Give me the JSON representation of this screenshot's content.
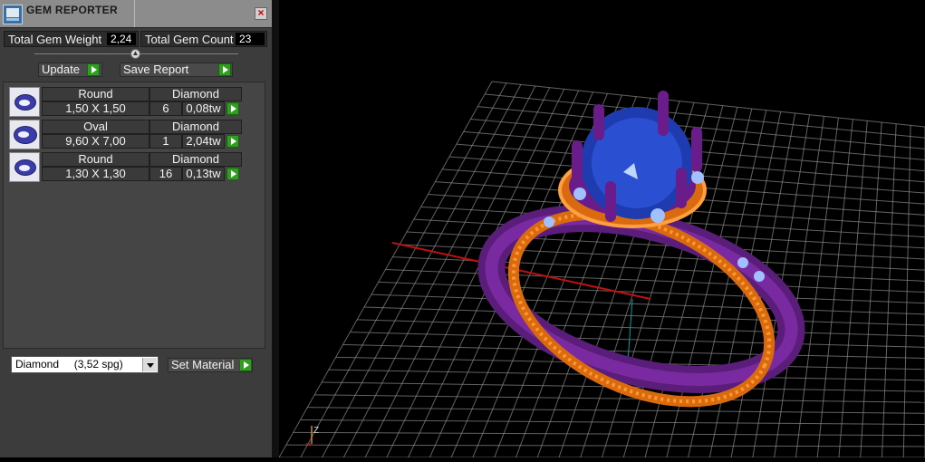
{
  "window": {
    "title": "GEM REPORTER"
  },
  "stats": {
    "weight_label": "Total Gem Weight",
    "weight_value": "2,24",
    "count_label": "Total Gem Count",
    "count_value": "23"
  },
  "actions": {
    "update_label": "Update",
    "save_label": "Save Report"
  },
  "gems": [
    {
      "shape": "Round",
      "material": "Diamond",
      "size": "1,50 X 1,50",
      "count": "6",
      "weight": "0,08tw"
    },
    {
      "shape": "Oval",
      "material": "Diamond",
      "size": "9,60 X 7,00",
      "count": "1",
      "weight": "2,04tw"
    },
    {
      "shape": "Round",
      "material": "Diamond",
      "size": "1,30 X 1,30",
      "count": "16",
      "weight": "0,13tw"
    }
  ],
  "material_select": {
    "value": "Diamond     (3,52 spg)",
    "set_label": "Set Material"
  },
  "viewport": {
    "axis_label": "Z",
    "colors": {
      "metal": "#f0801a",
      "prongs": "#6a1d8a",
      "stone": "#1e3cb0",
      "grid": "#8a8a8a"
    }
  }
}
